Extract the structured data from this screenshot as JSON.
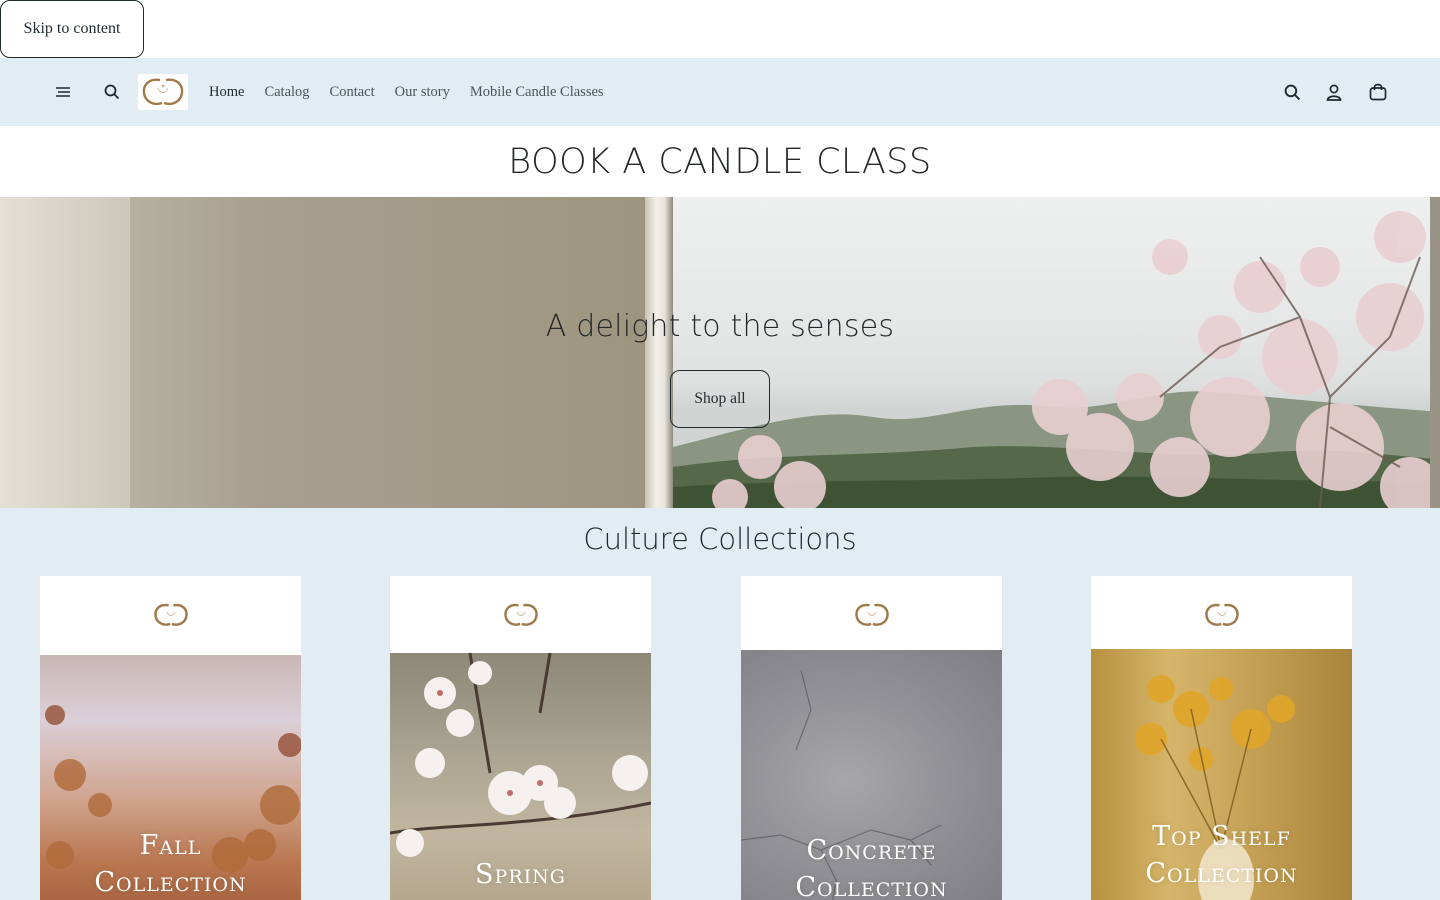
{
  "skip_link": "Skip to content",
  "header": {
    "nav": [
      "Home",
      "Catalog",
      "Contact",
      "Our story",
      "Mobile Candle Classes"
    ],
    "icons": [
      "menu-icon",
      "search-icon",
      "logo",
      "search-icon",
      "account-icon",
      "cart-icon"
    ]
  },
  "title_band": {
    "title": "BOOK A CANDLE CLASS"
  },
  "hero": {
    "heading": "A delight to the senses",
    "button": "Shop all"
  },
  "collections": {
    "title": "Culture Collections",
    "cards": [
      {
        "label_line1": "Fall",
        "label_line2": "Collection"
      },
      {
        "label_line1": "Spring",
        "label_line2": ""
      },
      {
        "label_line1": "Concrete",
        "label_line2": "Collection"
      },
      {
        "label_line1": "Top Shelf",
        "label_line2": "Collection"
      }
    ]
  },
  "colors": {
    "header_bg": "#e1ecf3",
    "text": "#1f2a2e",
    "logo_gold": "#a07a4a"
  }
}
